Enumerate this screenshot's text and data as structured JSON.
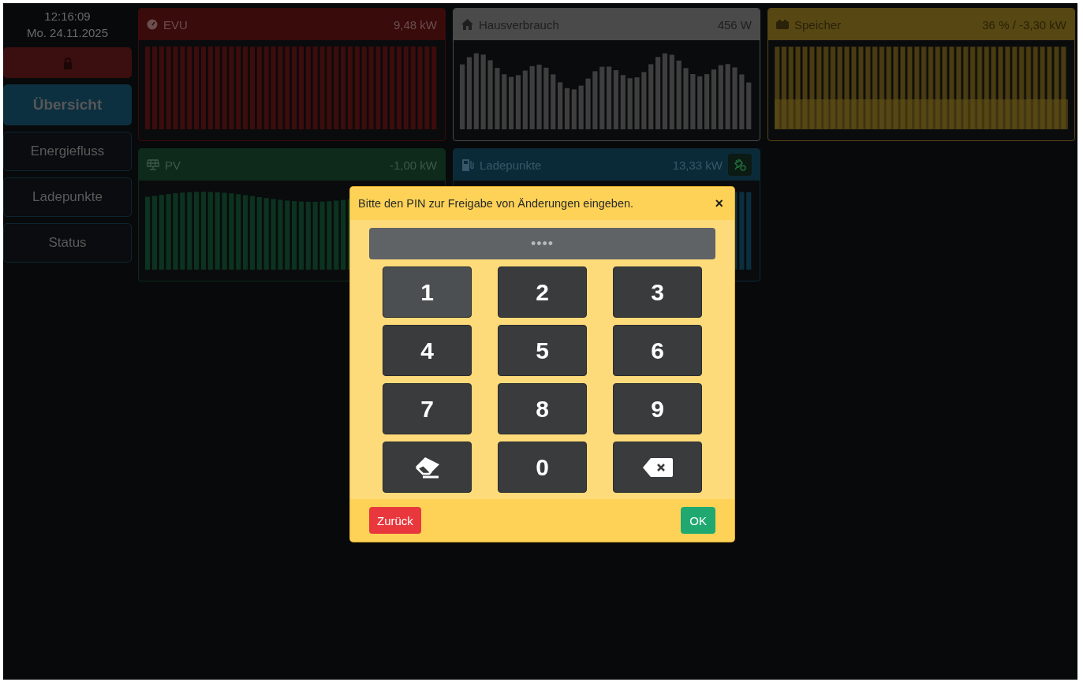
{
  "sidebar": {
    "time": "12:16:09",
    "date": "Mo. 24.11.2025",
    "lock_button": {
      "locked": true
    },
    "nav": [
      {
        "label": "Übersicht",
        "selected": true
      },
      {
        "label": "Energiefluss",
        "selected": false
      },
      {
        "label": "Ladepunkte",
        "selected": false
      },
      {
        "label": "Status",
        "selected": false
      }
    ]
  },
  "cards": [
    {
      "kind": "grid",
      "title": "EVU",
      "value": "9,48 kW",
      "color": "#3a0b0b"
    },
    {
      "kind": "house",
      "title": "Hausverbrauch",
      "value": "456 W",
      "color": "#4a4a4a"
    },
    {
      "kind": "battery",
      "title": "Speicher",
      "value": "36 % / -3,30 kW",
      "color": "#574713"
    },
    {
      "kind": "pv",
      "title": "PV",
      "value": "-1,00 kW",
      "color": "#0d2a1b"
    },
    {
      "kind": "charge",
      "title": "Ladepunkte",
      "value": "13,33 kW",
      "color": "#0b2a37"
    }
  ],
  "dialog": {
    "title": "Bitte den PIN zur Freigabe von Änderungen eingeben.",
    "close": "×",
    "pin": "••••",
    "keys": [
      {
        "kind": "digit",
        "label": "1",
        "selected": true
      },
      {
        "kind": "digit",
        "label": "2",
        "selected": false
      },
      {
        "kind": "digit",
        "label": "3",
        "selected": false
      },
      {
        "kind": "digit",
        "label": "4",
        "selected": false
      },
      {
        "kind": "digit",
        "label": "5",
        "selected": false
      },
      {
        "kind": "digit",
        "label": "6",
        "selected": false
      },
      {
        "kind": "digit",
        "label": "7",
        "selected": false
      },
      {
        "kind": "digit",
        "label": "8",
        "selected": false
      },
      {
        "kind": "digit",
        "label": "9",
        "selected": false
      },
      {
        "kind": "clear",
        "selected": false
      },
      {
        "kind": "digit",
        "label": "0",
        "selected": false
      },
      {
        "kind": "backspace",
        "selected": false
      }
    ],
    "back_button": "Zurück",
    "ok_button": "OK"
  }
}
